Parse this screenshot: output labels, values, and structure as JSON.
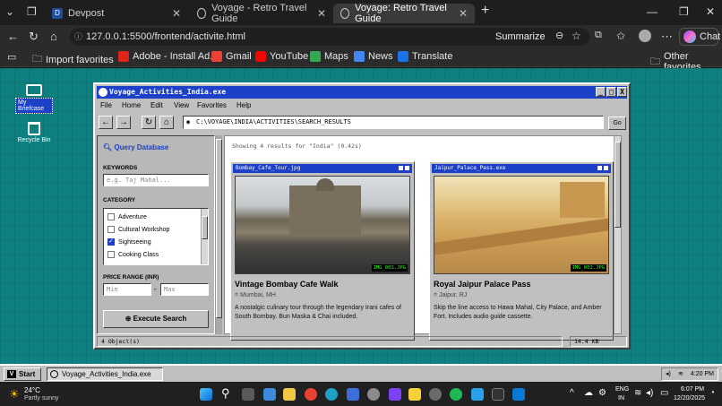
{
  "browser": {
    "tabs": [
      {
        "title": "Devpost",
        "close": "✕"
      },
      {
        "title": "Voyage - Retro Travel Guide",
        "close": "✕"
      },
      {
        "title": "Voyage: Retro Travel Guide",
        "close": "✕"
      }
    ],
    "new_tab": "+",
    "url": "127.0.0.1:5500/frontend/activite.html",
    "summarize": "Summarize",
    "chat": "Chat",
    "bookmarks": [
      "Import favorites",
      "Adobe - Install Ad...",
      "Gmail",
      "YouTube",
      "Maps",
      "News",
      "Translate"
    ],
    "other_favorites": "Other favorites"
  },
  "desktop": {
    "icons": [
      {
        "label": "My Briefcase"
      },
      {
        "label": "Recycle Bin"
      }
    ]
  },
  "window": {
    "title": "Voyage_Activities_India.exe",
    "controls": [
      "_",
      "□",
      "X"
    ],
    "menu": [
      "File",
      "Home",
      "Edit",
      "View",
      "Favorites",
      "Help"
    ],
    "address": "C:\\VOYAGE\\INDIA\\ACTIVITIES\\SEARCH_RESULTS",
    "go": "Go",
    "sidebar": {
      "heading": "Query Database",
      "keywords_label": "KEYWORDS",
      "keywords_placeholder": "e.g. Taj Mahal...",
      "category_label": "CATEGORY",
      "categories": [
        {
          "label": "Adventure",
          "checked": false
        },
        {
          "label": "Cultural Workshop",
          "checked": false
        },
        {
          "label": "Sightseeing",
          "checked": true
        },
        {
          "label": "Cooking Class",
          "checked": false
        }
      ],
      "price_label": "PRICE RANGE (INR)",
      "min_placeholder": "Min",
      "price_dash": "-",
      "max_placeholder": "Max",
      "execute": "Execute Search"
    },
    "results": {
      "info": "Showing 4 results for \"India\" (0.42s)",
      "cards": [
        {
          "file": "Bombay_Cafe_Tour.jpg",
          "tag": "IMG_001.JPG",
          "name": "Vintage Bombay Cafe Walk",
          "location": "Mumbai, MH",
          "description": "A nostalgic culinary tour through the legendary Irani cafes of South Bombay. Bun Maska & Chai included."
        },
        {
          "file": "Jaipur_Palace_Pass.exe",
          "tag": "IMG_002.JPG",
          "name": "Royal Jaipur Palace Pass",
          "location": "Jaipur, RJ",
          "description": "Skip the line access to Hawa Mahal, City Palace, and Amber Fort. Includes audio guide cassette."
        }
      ]
    },
    "status": {
      "objects": "4 Object(s)",
      "size": "14.4 KB"
    }
  },
  "retro_taskbar": {
    "start": "Start",
    "item": "Voyage_Activities_India.exe",
    "clock": "4:20 PM"
  },
  "windows_taskbar": {
    "weather_temp": "24°C",
    "weather_desc": "Partly sunny",
    "lang_top": "ENG",
    "lang_bottom": "IN",
    "time": "6:07 PM",
    "date": "12/20/2025"
  },
  "colors": {
    "desktop": "#0f8080",
    "title_blue": "#1c40c8",
    "retro_gray": "#c0c0c0"
  }
}
